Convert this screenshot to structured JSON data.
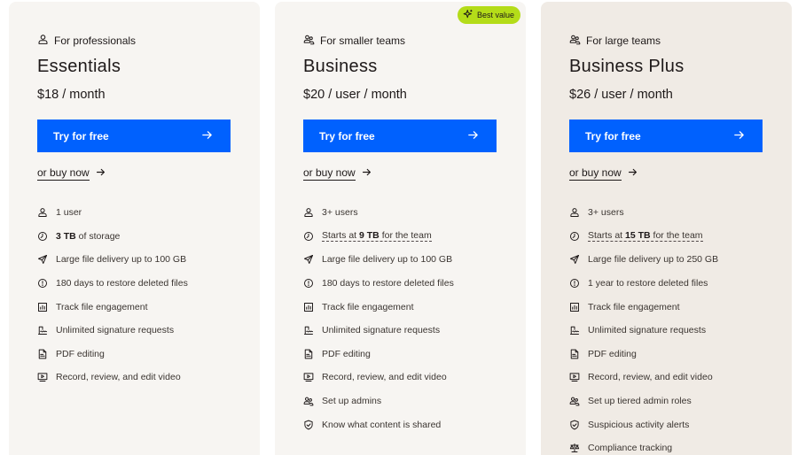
{
  "plans": [
    {
      "audience": "For professionals",
      "audience_icon": "person-icon",
      "name": "Essentials",
      "price": "$18 / month",
      "try_label": "Try for free",
      "buy_label": "or buy now",
      "features": [
        {
          "icon": "person-icon",
          "text": "1 user"
        },
        {
          "icon": "clock-icon",
          "bold": "3 TB",
          "rest": " of storage"
        },
        {
          "icon": "send-icon",
          "text": "Large file delivery up to 100 GB"
        },
        {
          "icon": "history-icon",
          "text": "180 days to restore deleted files"
        },
        {
          "icon": "chart-icon",
          "text": "Track file engagement"
        },
        {
          "icon": "signature-icon",
          "text": "Unlimited signature requests"
        },
        {
          "icon": "pdf-icon",
          "text": "PDF editing"
        },
        {
          "icon": "video-icon",
          "text": "Record, review, and edit video"
        }
      ]
    },
    {
      "badge": "Best value",
      "audience": "For smaller teams",
      "audience_icon": "people-icon",
      "name": "Business",
      "price": "$20 / user / month",
      "try_label": "Try for free",
      "buy_label": "or buy now",
      "features": [
        {
          "icon": "person-icon",
          "text": "3+ users"
        },
        {
          "icon": "clock-icon",
          "pre": "Starts at ",
          "bold": "9 TB",
          "rest": " for the team",
          "dotted": true
        },
        {
          "icon": "send-icon",
          "text": "Large file delivery up to 100 GB"
        },
        {
          "icon": "history-icon",
          "text": "180 days to restore deleted files"
        },
        {
          "icon": "chart-icon",
          "text": "Track file engagement"
        },
        {
          "icon": "signature-icon",
          "text": "Unlimited signature requests"
        },
        {
          "icon": "pdf-icon",
          "text": "PDF editing"
        },
        {
          "icon": "video-icon",
          "text": "Record, review, and edit video"
        },
        {
          "icon": "people-icon",
          "text": "Set up admins"
        },
        {
          "icon": "shield-icon",
          "text": "Know what content is shared"
        }
      ]
    },
    {
      "audience": "For large teams",
      "audience_icon": "people-icon",
      "name": "Business Plus",
      "price": "$26 / user / month",
      "try_label": "Try for free",
      "buy_label": "or buy now",
      "features": [
        {
          "icon": "person-icon",
          "text": "3+ users"
        },
        {
          "icon": "clock-icon",
          "pre": "Starts at ",
          "bold": "15 TB",
          "rest": " for the team",
          "dotted": true
        },
        {
          "icon": "send-icon",
          "text": "Large file delivery up to 250 GB"
        },
        {
          "icon": "history-icon",
          "text": "1 year to restore deleted files"
        },
        {
          "icon": "chart-icon",
          "text": "Track file engagement"
        },
        {
          "icon": "signature-icon",
          "text": "Unlimited signature requests"
        },
        {
          "icon": "pdf-icon",
          "text": "PDF editing"
        },
        {
          "icon": "video-icon",
          "text": "Record, review, and edit video"
        },
        {
          "icon": "people-icon",
          "text": "Set up tiered admin roles"
        },
        {
          "icon": "shield-icon",
          "text": "Suspicious activity alerts"
        },
        {
          "icon": "scale-icon",
          "text": "Compliance tracking"
        }
      ]
    }
  ],
  "colors": {
    "primary_button": "#0061fe",
    "badge": "#b4dc19",
    "card_background": "#f7f5f2",
    "card_background_alt": "#f0ebe5",
    "text": "#1e1919"
  }
}
